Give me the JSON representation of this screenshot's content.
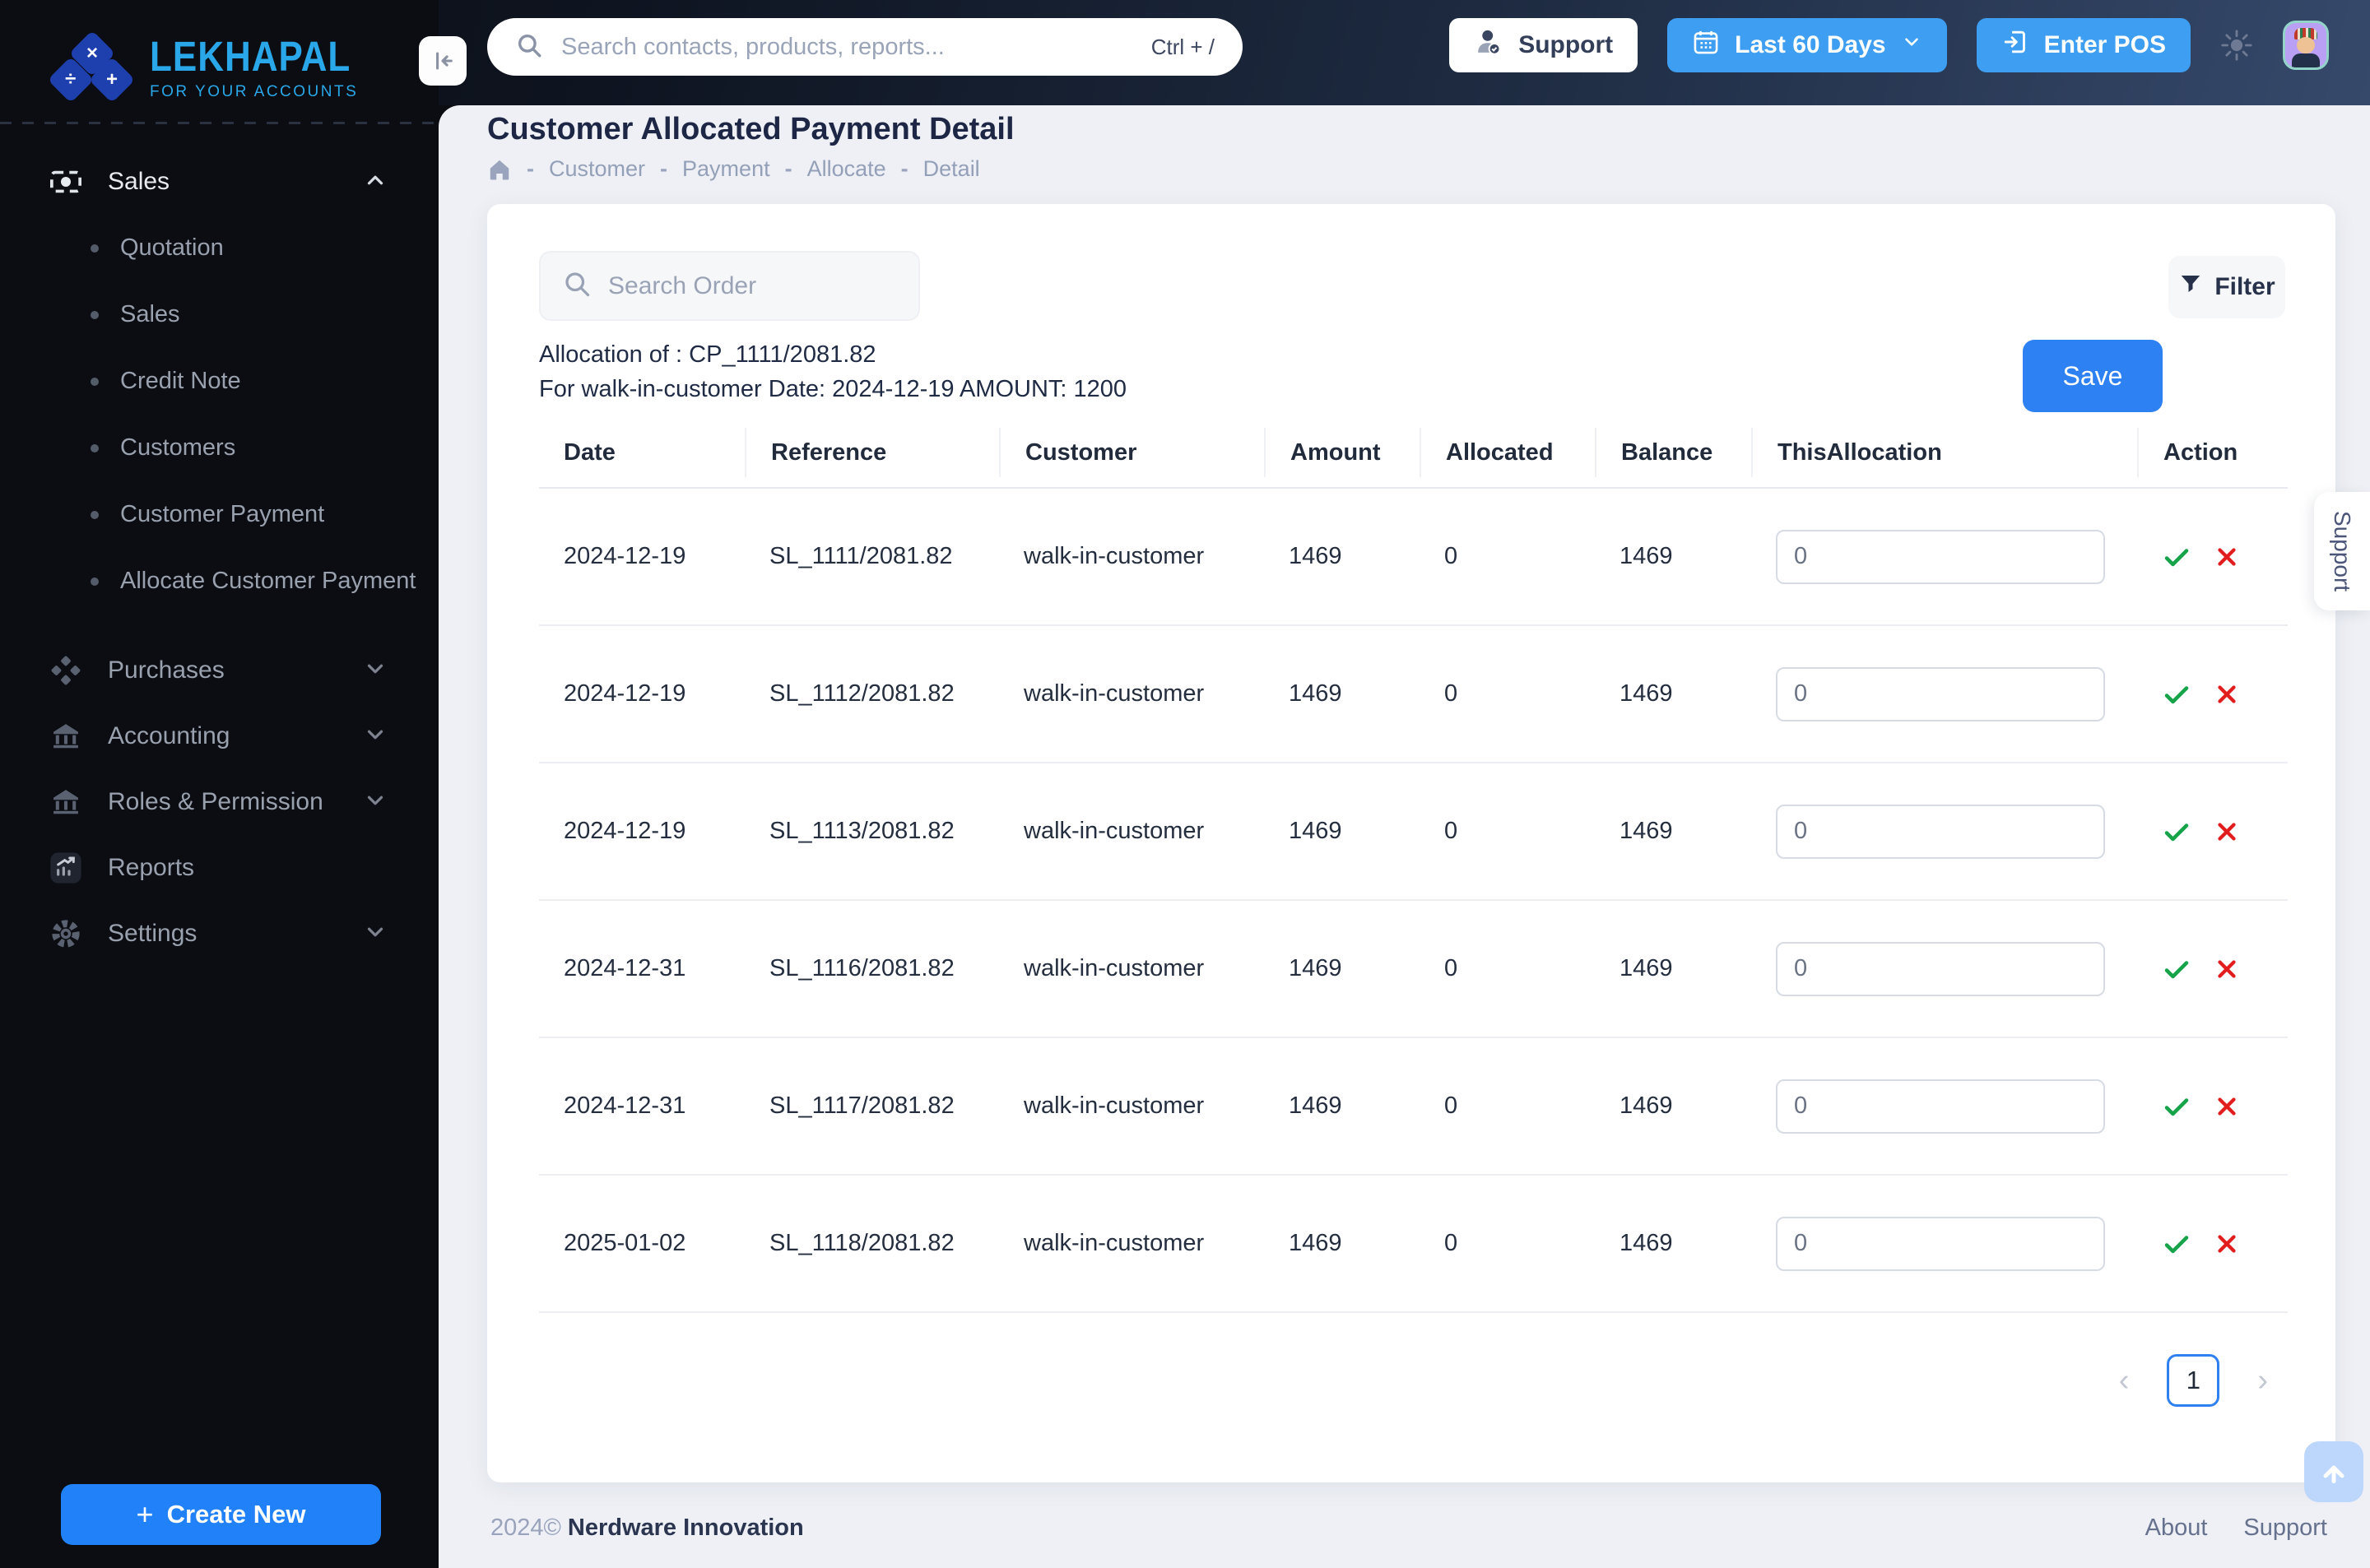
{
  "brand": {
    "name": "LEKHAPAL",
    "tagline": "FOR YOUR ACCOUNTS"
  },
  "header": {
    "search": {
      "placeholder": "Search contacts, products, reports...",
      "shortcut": "Ctrl + /"
    },
    "support_label": "Support",
    "date_range_label": "Last 60 Days",
    "enter_pos_label": "Enter POS"
  },
  "sidebar": {
    "sales": {
      "label": "Sales",
      "items": [
        "Quotation",
        "Sales",
        "Credit Note",
        "Customers",
        "Customer Payment",
        "Allocate Customer Payment"
      ]
    },
    "sections": [
      {
        "label": "Purchases"
      },
      {
        "label": "Accounting"
      },
      {
        "label": "Roles & Permission"
      },
      {
        "label": "Reports"
      },
      {
        "label": "Settings"
      }
    ],
    "create_new_label": "Create New"
  },
  "page": {
    "title": "Customer Allocated Payment Detail",
    "breadcrumb": [
      "Customer",
      "Payment",
      "Allocate",
      "Detail"
    ]
  },
  "card": {
    "search_order_placeholder": "Search Order",
    "filter_label": "Filter",
    "allocation_line1": "Allocation of : CP_1111/2081.82",
    "allocation_line2": "For walk-in-customer Date: 2024-12-19 AMOUNT: 1200",
    "save_label": "Save"
  },
  "table": {
    "columns": [
      "Date",
      "Reference",
      "Customer",
      "Amount",
      "Allocated",
      "Balance",
      "ThisAllocation",
      "Action"
    ],
    "rows": [
      {
        "date": "2024-12-19",
        "reference": "SL_1111/2081.82",
        "customer": "walk-in-customer",
        "amount": "1469",
        "allocated": "0",
        "balance": "1469",
        "this_allocation": "0"
      },
      {
        "date": "2024-12-19",
        "reference": "SL_1112/2081.82",
        "customer": "walk-in-customer",
        "amount": "1469",
        "allocated": "0",
        "balance": "1469",
        "this_allocation": "0"
      },
      {
        "date": "2024-12-19",
        "reference": "SL_1113/2081.82",
        "customer": "walk-in-customer",
        "amount": "1469",
        "allocated": "0",
        "balance": "1469",
        "this_allocation": "0"
      },
      {
        "date": "2024-12-31",
        "reference": "SL_1116/2081.82",
        "customer": "walk-in-customer",
        "amount": "1469",
        "allocated": "0",
        "balance": "1469",
        "this_allocation": "0"
      },
      {
        "date": "2024-12-31",
        "reference": "SL_1117/2081.82",
        "customer": "walk-in-customer",
        "amount": "1469",
        "allocated": "0",
        "balance": "1469",
        "this_allocation": "0"
      },
      {
        "date": "2025-01-02",
        "reference": "SL_1118/2081.82",
        "customer": "walk-in-customer",
        "amount": "1469",
        "allocated": "0",
        "balance": "1469",
        "this_allocation": "0"
      }
    ]
  },
  "pagination": {
    "page": "1"
  },
  "footer": {
    "year": "2024©",
    "company": "Nerdware Innovation",
    "links": [
      "About",
      "Support"
    ]
  },
  "floating": {
    "support_tab": "Support"
  },
  "colors": {
    "accent_blue": "#2e81f2",
    "header_button_blue": "#3d9ef2",
    "brand_blue": "#2aa7e8",
    "success_green": "#17a34a",
    "danger_red": "#e11d1d"
  }
}
